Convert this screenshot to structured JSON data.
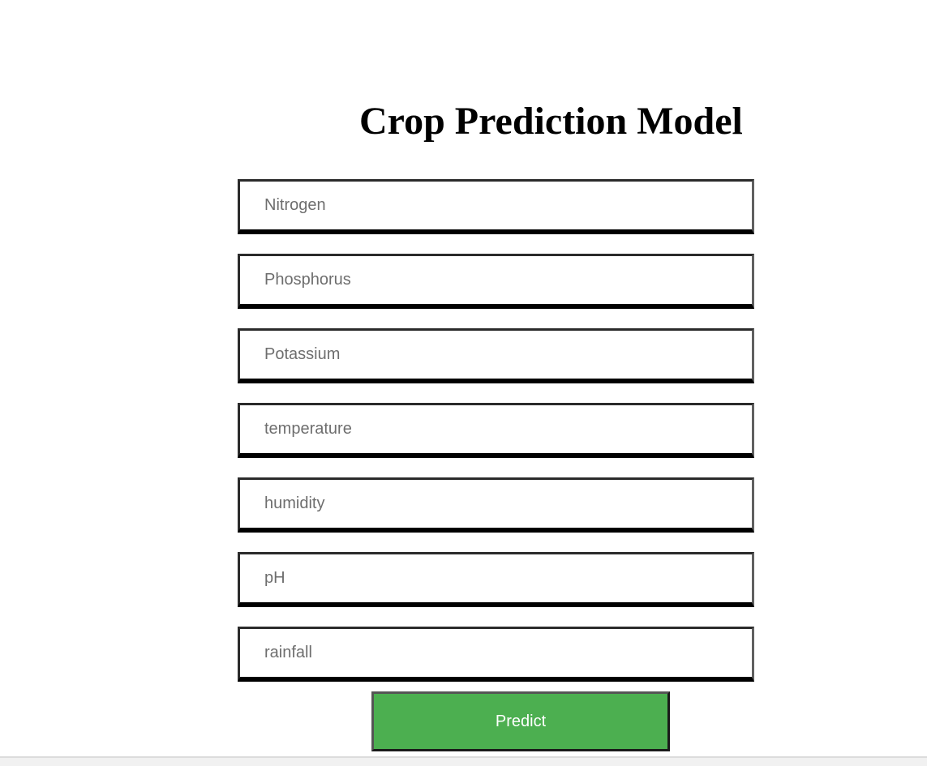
{
  "header": {
    "title": "Crop Prediction Model"
  },
  "form": {
    "fields": [
      {
        "name": "nitrogen",
        "placeholder": "Nitrogen",
        "value": ""
      },
      {
        "name": "phosphorus",
        "placeholder": "Phosphorus",
        "value": ""
      },
      {
        "name": "potassium",
        "placeholder": "Potassium",
        "value": ""
      },
      {
        "name": "temperature",
        "placeholder": "temperature",
        "value": ""
      },
      {
        "name": "humidity",
        "placeholder": "humidity",
        "value": ""
      },
      {
        "name": "ph",
        "placeholder": "pH",
        "value": ""
      },
      {
        "name": "rainfall",
        "placeholder": "rainfall",
        "value": ""
      }
    ],
    "submit_label": "Predict"
  },
  "colors": {
    "button_bg": "#4caf50",
    "button_text": "#ffffff",
    "placeholder_text": "#6e6e6e"
  }
}
